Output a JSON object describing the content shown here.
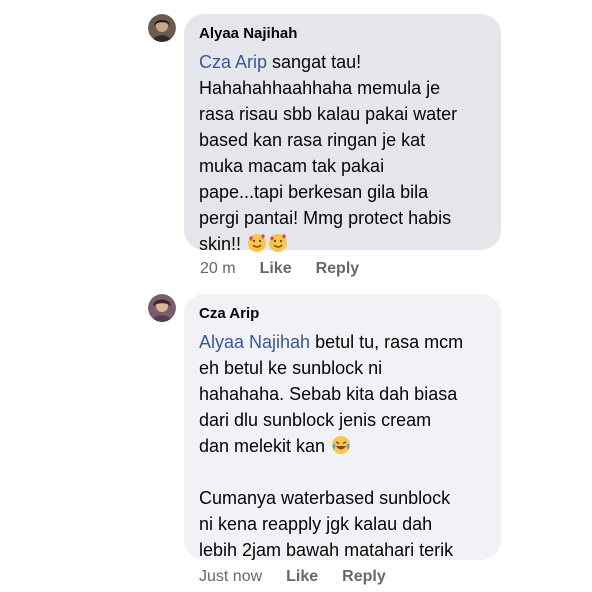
{
  "comments": [
    {
      "author": "Alyaa Najihah",
      "mention": "Cza Arip",
      "first_line_rest": " sangat tau!",
      "lines": [
        "Hahahahhaahhaha memula je",
        "rasa risau sbb kalau pakai water",
        "based kan rasa ringan je kat",
        "muka macam tak pakai",
        "pape...tapi berkesan gila bila",
        "pergi pantai! Mmg protect habis"
      ],
      "last_line": "skin!! ",
      "emoji": "smiling-face-with-hearts-icon",
      "time": "20 m",
      "like_label": "Like",
      "reply_label": "Reply"
    },
    {
      "author": "Cza Arip",
      "mention": "Alyaa Najihah",
      "first_line_rest": " betul tu, rasa mcm",
      "lines": [
        "eh betul ke sunblock ni",
        "hahahaha. Sebab kita dah biasa",
        "dari dlu sunblock jenis cream"
      ],
      "emoji_line": "dan melekit kan ",
      "emoji": "tears-of-joy-icon",
      "lines_after": [
        "Cumanya waterbased sunblock",
        "ni kena reapply jgk kalau dah",
        "lebih 2jam bawah matahari terik"
      ],
      "time": "Just now",
      "like_label": "Like",
      "reply_label": "Reply"
    }
  ]
}
